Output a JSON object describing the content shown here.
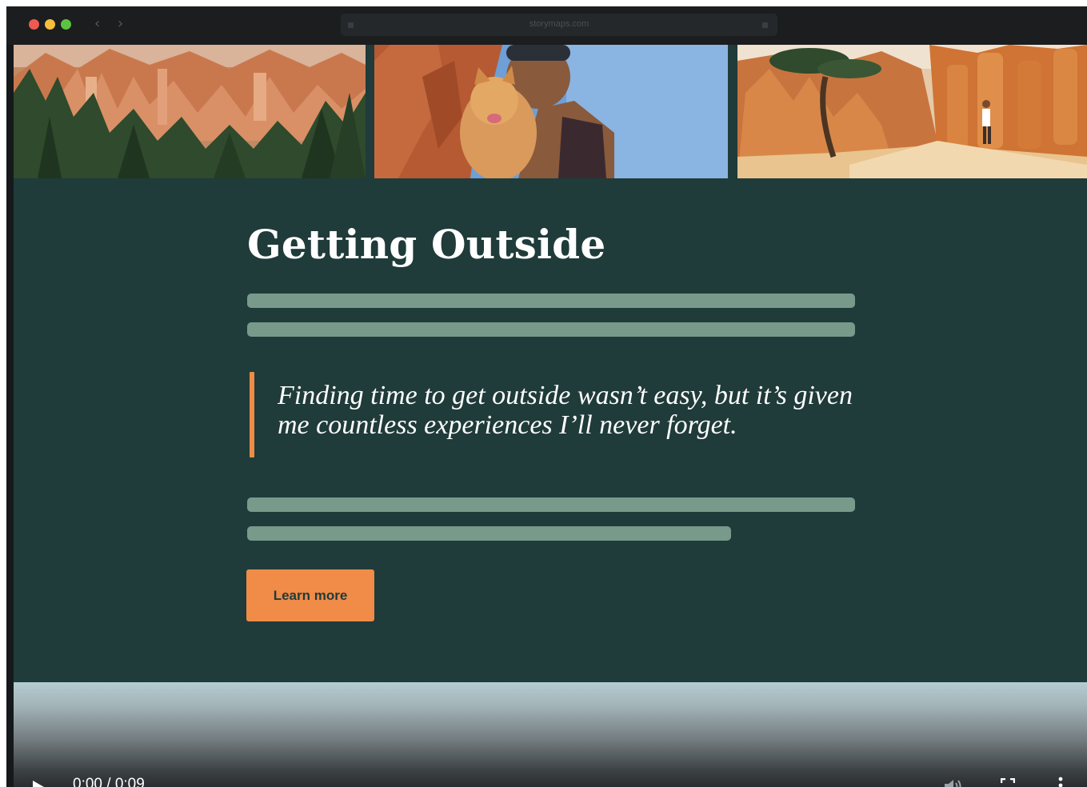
{
  "browser": {
    "url": "storymaps.com"
  },
  "photos": [
    {
      "icon": "canyon-hoodoos-forest-photo"
    },
    {
      "icon": "person-with-dog-photo"
    },
    {
      "icon": "hiker-on-trail-photo"
    }
  ],
  "story": {
    "title": "Getting Outside",
    "quote": "Finding time to get outside wasn’t easy, but it’s given me countless experiences I’ll never forget.",
    "cta_label": "Learn more"
  },
  "video": {
    "time_display": "0:00 / 0:09",
    "progress": 0
  },
  "colors": {
    "page_background": "#1f3b3a",
    "accent": "#f08b48",
    "placeholder_line": "#789a8b"
  }
}
